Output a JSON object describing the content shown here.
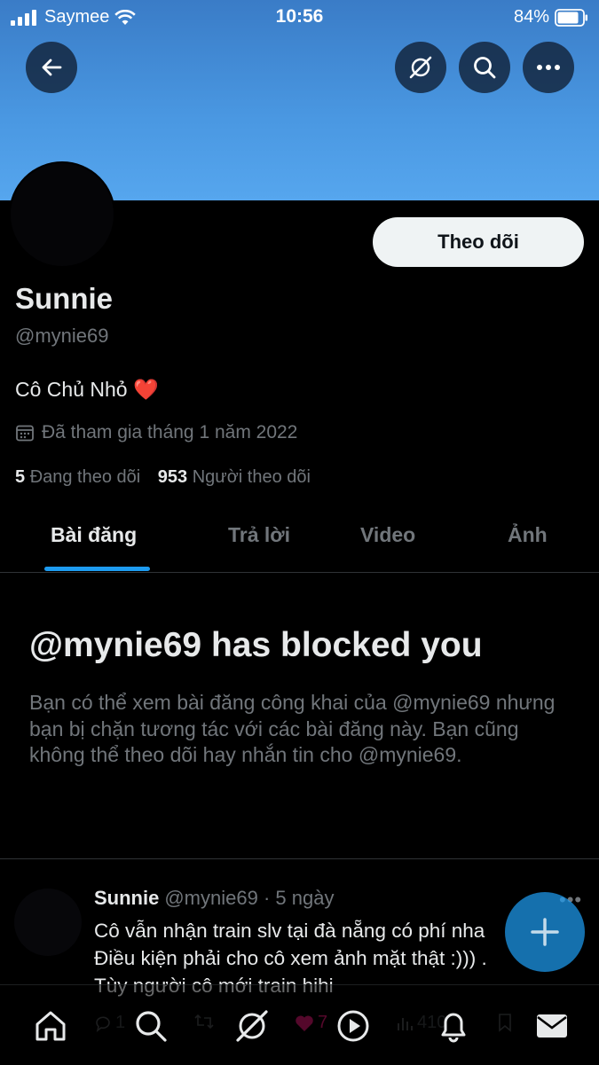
{
  "status_bar": {
    "carrier": "Saymee",
    "time": "10:56",
    "battery": "84%"
  },
  "header_icons": [
    "back-arrow-icon",
    "grok-icon",
    "search-icon",
    "more-icon"
  ],
  "profile": {
    "follow_label": "Theo dõi",
    "name": "Sunnie",
    "handle": "@mynie69",
    "bio": "Cô Chủ Nhỏ",
    "bio_emoji": "❤️",
    "joined": "Đã tham gia tháng 1 năm 2022",
    "following_count": "5",
    "following_label": "Đang theo dõi",
    "followers_count": "953",
    "followers_label": "Người theo dõi"
  },
  "tabs": [
    {
      "label": "Bài đăng",
      "active": true
    },
    {
      "label": "Trả lời",
      "active": false
    },
    {
      "label": "Video",
      "active": false
    },
    {
      "label": "Ảnh",
      "active": false
    }
  ],
  "blocked": {
    "title": "@mynie69 has blocked you",
    "text": "Bạn có thể xem bài đăng công khai của @mynie69 nhưng bạn bị chặn tương tác với các bài đăng này. Bạn cũng không thể theo dõi hay nhắn tin cho @mynie69."
  },
  "post": {
    "name": "Sunnie",
    "handle": "@mynie69",
    "time": "· 5 ngày",
    "lines": [
      "Cô vẫn nhận train slv tại đà nẵng có phí nha",
      "Điều kiện phải cho cô xem ảnh mặt thật :))) .",
      "Tùy người cô mới train hihi"
    ],
    "reply_count": "1",
    "like_count": "7",
    "view_count": "410"
  },
  "bottom_nav": [
    "home-icon",
    "search-icon",
    "grok-icon",
    "video-icon",
    "notifications-icon",
    "messages-icon"
  ],
  "colors": {
    "accent": "#1d9bf0",
    "banner": "#4a98e2",
    "muted_text": "#71767b",
    "like": "#f91880"
  }
}
